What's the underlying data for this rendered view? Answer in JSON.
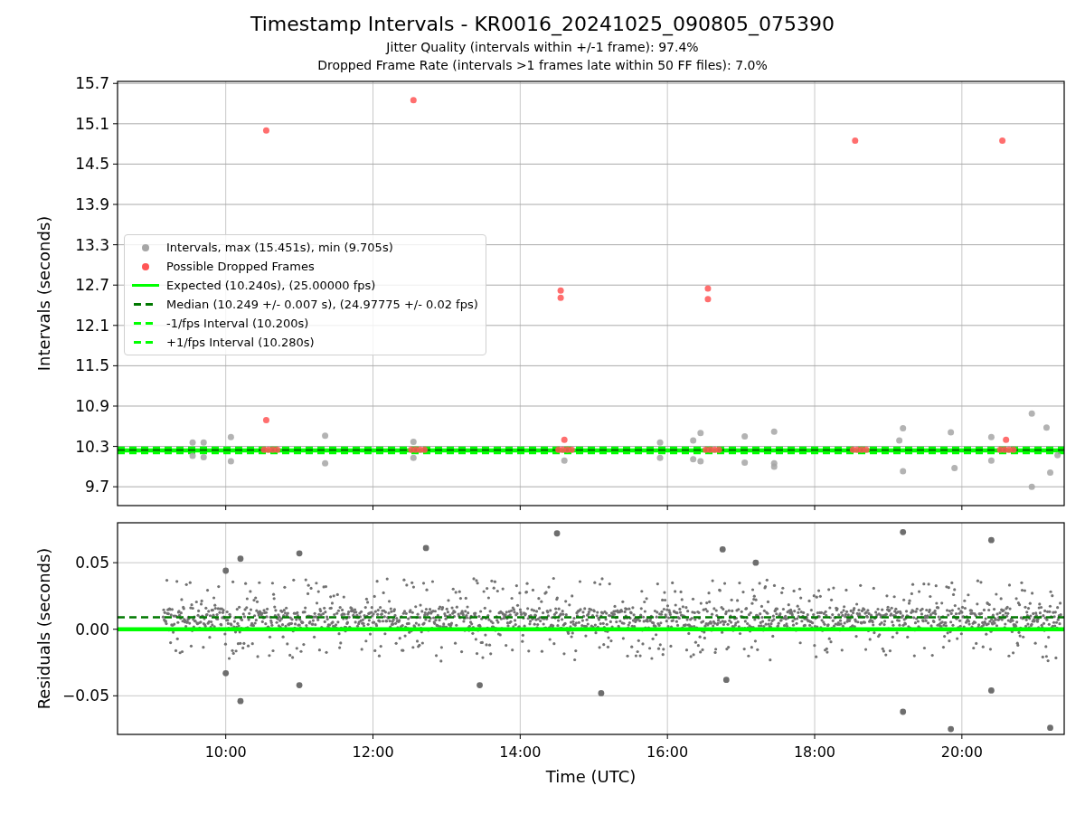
{
  "figure": {
    "title": "Timestamp Intervals - KR0016_20241025_090805_075390",
    "subtitles": [
      "Jitter Quality (intervals within +/-1 frame): 97.4%",
      "Dropped Frame Rate (intervals >1 frames late within 50 FF files): 7.0%"
    ]
  },
  "intervals_plot": {
    "chart_data": {
      "type": "scatter",
      "ylabel": "Intervals (seconds)",
      "xlim": [
        8.53,
        21.39
      ],
      "ylim": [
        9.42,
        15.73
      ],
      "grid": true,
      "yticks": [
        {
          "value": 9.7,
          "label": "9.7"
        },
        {
          "value": 10.3,
          "label": "10.3"
        },
        {
          "value": 10.9,
          "label": "10.9"
        },
        {
          "value": 11.5,
          "label": "11.5"
        },
        {
          "value": 12.1,
          "label": "12.1"
        },
        {
          "value": 12.7,
          "label": "12.7"
        },
        {
          "value": 13.3,
          "label": "13.3"
        },
        {
          "value": 13.9,
          "label": "13.9"
        },
        {
          "value": 14.5,
          "label": "14.5"
        },
        {
          "value": 15.1,
          "label": "15.1"
        },
        {
          "value": 15.7,
          "label": "15.7"
        }
      ],
      "series": [
        {
          "name": "Intervals, max (15.451s), min (9.705s)",
          "color": "#a6a6a6",
          "x": [
            9.55,
            9.55,
            9.7,
            9.7,
            10.07,
            10.07,
            11.35,
            11.35,
            12.55,
            12.55,
            14.6,
            15.9,
            15.9,
            16.35,
            16.35,
            16.45,
            16.45,
            17.05,
            17.05,
            17.45,
            17.45,
            17.45,
            19.15,
            19.2,
            19.2,
            19.85,
            19.9,
            20.4,
            20.4,
            20.95,
            20.95,
            21.15,
            21.2,
            21.3
          ],
          "values": [
            10.36,
            10.16,
            10.36,
            10.14,
            10.44,
            10.08,
            10.46,
            10.05,
            10.37,
            10.13,
            10.09,
            10.36,
            10.13,
            10.39,
            10.11,
            10.5,
            10.08,
            10.45,
            10.06,
            10.52,
            10.05,
            10.0,
            10.39,
            10.57,
            9.93,
            10.51,
            9.98,
            10.44,
            10.09,
            10.79,
            9.7,
            10.58,
            9.91,
            10.17
          ]
        },
        {
          "name": "Possible Dropped Frames",
          "color": "#ff5555",
          "x": [
            10.55,
            12.55,
            18.55,
            20.55,
            14.55,
            14.55,
            16.55,
            16.55,
            10.55,
            14.6,
            20.6,
            10.52,
            10.58,
            10.64,
            10.7,
            12.52,
            12.58,
            12.64,
            12.7,
            14.52,
            14.58,
            14.64,
            14.7,
            16.52,
            16.58,
            16.64,
            16.7,
            18.52,
            18.58,
            18.64,
            18.7,
            20.52,
            20.58,
            20.64,
            20.7
          ],
          "values": [
            15.0,
            15.45,
            14.85,
            14.85,
            12.62,
            12.51,
            12.65,
            12.49,
            10.69,
            10.4,
            10.4,
            10.25,
            10.25,
            10.25,
            10.25,
            10.25,
            10.25,
            10.25,
            10.25,
            10.25,
            10.25,
            10.25,
            10.25,
            10.25,
            10.25,
            10.25,
            10.25,
            10.25,
            10.25,
            10.25,
            10.25,
            10.25,
            10.25,
            10.25,
            10.25
          ]
        }
      ],
      "ref_lines": [
        {
          "axis": "y",
          "value": 10.24,
          "color": "#00ff00",
          "label": "Expected (10.240s), (25.00000 fps)"
        },
        {
          "axis": "y",
          "value": 10.249,
          "color": "#007800",
          "label": "Median (10.249 +/- 0.007 s), (24.97775 +/- 0.02 fps)"
        },
        {
          "axis": "y",
          "value": 10.2,
          "color": "#00ff00",
          "label": "-1/fps Interval (10.200s)"
        },
        {
          "axis": "y",
          "value": 10.28,
          "color": "#00ff00",
          "label": "+1/fps Interval (10.280s)"
        }
      ]
    }
  },
  "residuals_plot": {
    "chart_data": {
      "type": "scatter",
      "ylabel": "Residuals (seconds)",
      "xlabel": "Time (UTC)",
      "xlim": [
        8.53,
        21.39
      ],
      "ylim": [
        -0.079,
        0.08
      ],
      "grid": true,
      "xticks": [
        {
          "value": 10,
          "label": "10:00"
        },
        {
          "value": 12,
          "label": "12:00"
        },
        {
          "value": 14,
          "label": "14:00"
        },
        {
          "value": 16,
          "label": "16:00"
        },
        {
          "value": 18,
          "label": "18:00"
        },
        {
          "value": 20,
          "label": "20:00"
        }
      ],
      "yticks": [
        {
          "value": 0.05,
          "label": "0.05"
        },
        {
          "value": 0,
          "label": "0.00"
        },
        {
          "value": -0.05,
          "label": "−0.05"
        }
      ],
      "series": [
        {
          "color": "#6e6e6e",
          "x": [
            10.0,
            10.2,
            11.0,
            12.72,
            14.5,
            17.2,
            19.2,
            20.4,
            10.0,
            10.2,
            11.0,
            13.45,
            15.1,
            19.2,
            19.85,
            20.4,
            21.2,
            16.75,
            16.8
          ],
          "values": [
            0.044,
            0.053,
            0.057,
            0.061,
            0.072,
            0.05,
            0.073,
            0.067,
            -0.033,
            -0.054,
            -0.042,
            -0.042,
            -0.048,
            -0.062,
            -0.075,
            -0.046,
            -0.074,
            0.06,
            -0.038
          ]
        }
      ],
      "ref_lines": [
        {
          "axis": "y",
          "value": 0,
          "color": "#00ff00"
        },
        {
          "axis": "y",
          "value": 0.009,
          "color": "#007800"
        }
      ]
    }
  }
}
